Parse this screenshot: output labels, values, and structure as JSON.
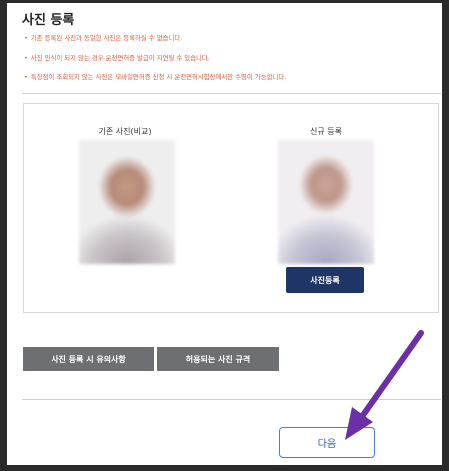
{
  "page": {
    "title": "사진 등록",
    "notices": [
      "기존 등록된 사진과 동일한 사진은 등록하실 수 없습니다.",
      "사진 인식이 되지 않는 경우 운전면허증 발급이 지연될 수 있습니다.",
      "특징점이 조회되지 않는 사진은 모바일면허증 신청 시 운전면허시험장에서만 수령이 가능합니다."
    ]
  },
  "photos": {
    "existing_label": "기존 사진(비교)",
    "new_label": "신규 등록",
    "register_button": "사진등록"
  },
  "info_buttons": {
    "precautions": "사진 등록 시 유의사항",
    "allowed_rules": "허용되는 사진 규격"
  },
  "footer": {
    "next_button": "다음"
  },
  "colors": {
    "notice": "#e45b3a",
    "primary_button": "#1f3566",
    "gray_button": "#6d6f72",
    "arrow": "#6b2fa8",
    "next_border": "#4a7ec9"
  }
}
